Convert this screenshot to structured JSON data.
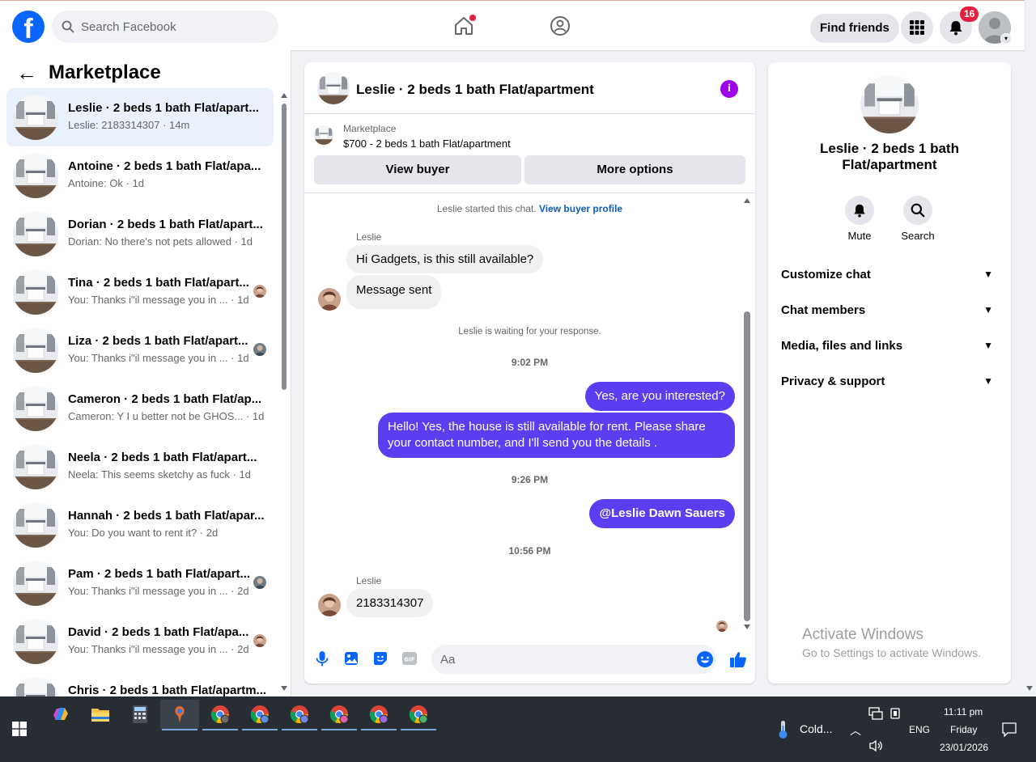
{
  "header": {
    "logo": "f",
    "search_placeholder": "Search Facebook",
    "find_friends": "Find friends",
    "notification_count": "16"
  },
  "left": {
    "title": "Marketplace",
    "conversations": [
      {
        "name": "Leslie · 2 beds 1 bath Flat/apart...",
        "preview": "Leslie: 2183314307 · 14m",
        "active": true
      },
      {
        "name": "Antoine · 2 beds 1 bath Flat/apa...",
        "preview": "Antoine: Ok · 1d"
      },
      {
        "name": "Dorian · 2 beds 1 bath Flat/apart...",
        "preview": "Dorian: No there's not pets allowed · 1d"
      },
      {
        "name": "Tina · 2 beds 1 bath Flat/apart...",
        "preview": "You: Thanks i\"il message you in ... · 1d",
        "avatar": true
      },
      {
        "name": "Liza · 2 beds 1 bath Flat/apart...",
        "preview": "You: Thanks i\"il message you in ... · 1d",
        "avatar": true
      },
      {
        "name": "Cameron · 2 beds 1 bath Flat/ap...",
        "preview": "Cameron: Y I u better not be GHOS... · 1d"
      },
      {
        "name": "Neela · 2 beds 1 bath Flat/apart...",
        "preview": "Neela: This seems sketchy as fuck · 1d"
      },
      {
        "name": "Hannah · 2 beds 1 bath Flat/apar...",
        "preview": "You: Do you want to rent it? · 2d"
      },
      {
        "name": "Pam · 2 beds 1 bath Flat/apart...",
        "preview": "You: Thanks i\"il message you in ... · 2d",
        "avatar": true
      },
      {
        "name": "David · 2 beds 1 bath Flat/apa...",
        "preview": "You: Thanks i\"il message you in ... · 2d",
        "avatar": true
      },
      {
        "name": "Chris · 2 beds 1 bath Flat/apartm...",
        "preview": ""
      }
    ]
  },
  "chat": {
    "title": "Leslie · 2 beds 1 bath Flat/apartment",
    "marketplace_label": "Marketplace",
    "listing": "$700 - 2 beds 1 bath Flat/apartment",
    "view_buyer": "View buyer",
    "more_options": "More options",
    "started": "Leslie started this chat.",
    "view_buyer_profile": "View buyer profile",
    "sender_name": "Leslie",
    "msg1": "Hi Gadgets, is this still available?",
    "msg2": "Message sent",
    "waiting": "Leslie is waiting for your response.",
    "time1": "9:02 PM",
    "out1": "Yes, are you interested?",
    "out2": "Hello! Yes, the house is still available for rent. Please share your contact number, and I'll send you the details .",
    "time2": "9:26 PM",
    "out3": "@Leslie Dawn Sauers",
    "time3": "10:56 PM",
    "msg3": "2183314307",
    "input_placeholder": "Aa"
  },
  "right": {
    "title": "Leslie · 2 beds 1 bath Flat/apartment",
    "mute": "Mute",
    "search": "Search",
    "sections": [
      "Customize chat",
      "Chat members",
      "Media, files and links",
      "Privacy & support"
    ],
    "activate_title": "Activate Windows",
    "activate_sub": "Go to Settings to activate Windows."
  },
  "taskbar": {
    "weather": "Cold...",
    "lang": "ENG",
    "time": "11:11 pm",
    "day": "Friday",
    "date": "23/01/2026"
  },
  "colors": {
    "brand": "#0866ff",
    "outgoing_bubble": "#5a3ff0",
    "notification": "#e41e3f",
    "info_icon": "#9b00e8"
  }
}
